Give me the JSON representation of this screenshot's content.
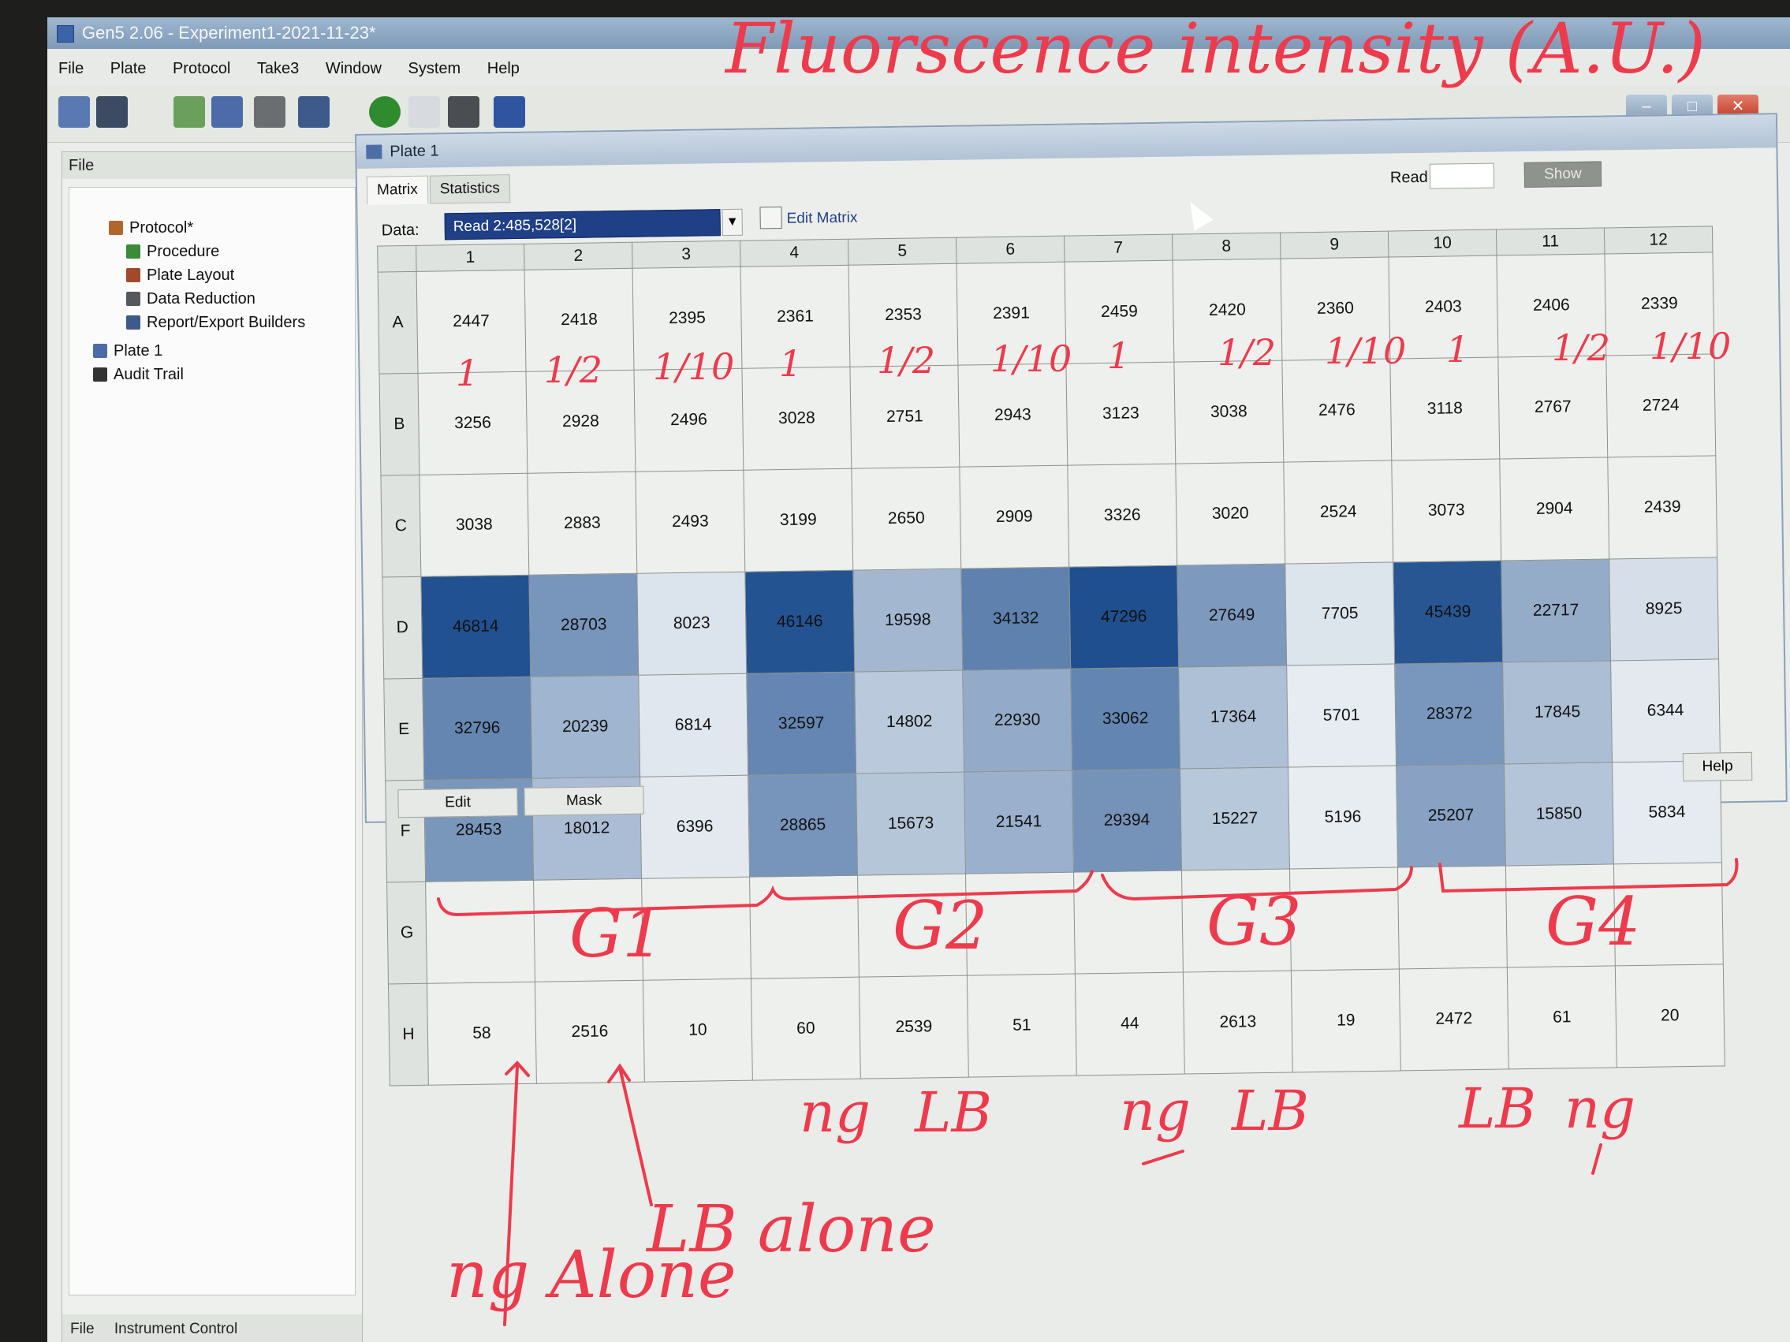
{
  "window": {
    "title": "Gen5 2.06 - Experiment1-2021-11-23*",
    "menu": [
      "File",
      "Plate",
      "Protocol",
      "Take3",
      "Window",
      "System",
      "Help"
    ]
  },
  "file_panel": {
    "header": "File",
    "tree": [
      "Protocol*",
      "Procedure",
      "Plate Layout",
      "Data Reduction",
      "Report/Export Builders",
      "Plate 1",
      "Audit Trail"
    ],
    "bottom_tabs": [
      "File",
      "Instrument Control"
    ]
  },
  "plate_window": {
    "title": "Plate 1",
    "tabs": [
      "Matrix",
      "Statistics"
    ],
    "read_label": "Read #:",
    "show_label": "Show",
    "data_label": "Data:",
    "data_value": "Read 2:485,528[2]",
    "edit_matrix_label": "Edit Matrix",
    "edit_button": "Edit",
    "mask_button": "Mask",
    "help_button": "Help"
  },
  "plate": {
    "columns": [
      "1",
      "2",
      "3",
      "4",
      "5",
      "6",
      "7",
      "8",
      "9",
      "10",
      "11",
      "12"
    ],
    "rows": [
      {
        "label": "A",
        "values": [
          "2447",
          "2418",
          "2395",
          "2361",
          "2353",
          "2391",
          "2459",
          "2420",
          "2360",
          "2403",
          "2406",
          "2339"
        ]
      },
      {
        "label": "B",
        "values": [
          "3256",
          "2928",
          "2496",
          "3028",
          "2751",
          "2943",
          "3123",
          "3038",
          "2476",
          "3118",
          "2767",
          "2724"
        ]
      },
      {
        "label": "C",
        "values": [
          "3038",
          "2883",
          "2493",
          "3199",
          "2650",
          "2909",
          "3326",
          "3020",
          "2524",
          "3073",
          "2904",
          "2439"
        ]
      },
      {
        "label": "D",
        "values": [
          "46814",
          "28703",
          "8023",
          "46146",
          "19598",
          "34132",
          "47296",
          "27649",
          "7705",
          "45439",
          "22717",
          "8925"
        ]
      },
      {
        "label": "E",
        "values": [
          "32796",
          "20239",
          "6814",
          "32597",
          "14802",
          "22930",
          "33062",
          "17364",
          "5701",
          "28372",
          "17845",
          "6344"
        ]
      },
      {
        "label": "F",
        "values": [
          "28453",
          "18012",
          "6396",
          "28865",
          "15673",
          "21541",
          "29394",
          "15227",
          "5196",
          "25207",
          "15850",
          "5834"
        ]
      },
      {
        "label": "G",
        "values": [
          "",
          "",
          "",
          "",
          "",
          "",
          "",
          "",
          "",
          "",
          "",
          ""
        ]
      },
      {
        "label": "H",
        "values": [
          "58",
          "2516",
          "10",
          "60",
          "2539",
          "51",
          "44",
          "2613",
          "19",
          "2472",
          "61",
          "20"
        ]
      }
    ],
    "heat_colors": {
      "low": "#eef2f5",
      "high": "#1f4f8f"
    }
  },
  "annotations": {
    "title": "Fluorscence intensity (A.U.)",
    "dilutions": [
      "1",
      "1/2",
      "1/10",
      "1",
      "1/2",
      "1/10",
      "1",
      "1/2",
      "1/10",
      "1",
      "1/2",
      "1/10"
    ],
    "groups": [
      "G1",
      "G2",
      "G3",
      "G4"
    ],
    "h_row_notes": [
      "ng",
      "LB",
      "ng",
      "LB",
      "LB",
      "ng"
    ],
    "ng_alone": "ng Alone",
    "lb_alone": "LB alone"
  }
}
